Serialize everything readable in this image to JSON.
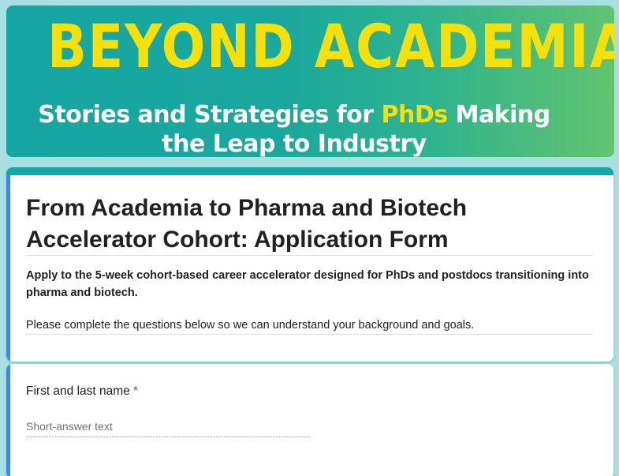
{
  "banner": {
    "title": "BEYOND ACADEMIA",
    "subtitle_line1_pre": "Stories and Strategies for ",
    "subtitle_highlight": "PhDs",
    "subtitle_line1_post": " Making",
    "subtitle_line2": "the Leap to Industry",
    "colors": {
      "title": "#f5e00c",
      "highlight": "#f5e00c",
      "gradient_start": "#16a5a3",
      "gradient_end": "#62c46f"
    }
  },
  "form": {
    "title": "From Academia to Pharma and Biotech Accelerator Cohort: Application Form",
    "description_bold": "Apply to the 5-week cohort-based career accelerator designed for PhDs and postdocs transitioning into pharma and biotech.",
    "description": "Please complete the questions below so we can understand your background and goals.",
    "accent_color": "#12a7a8",
    "side_accent_color": "#4285f4"
  },
  "questions": [
    {
      "label": "First and last name",
      "required_marker": "*",
      "placeholder": "Short-answer text",
      "value": ""
    }
  ]
}
